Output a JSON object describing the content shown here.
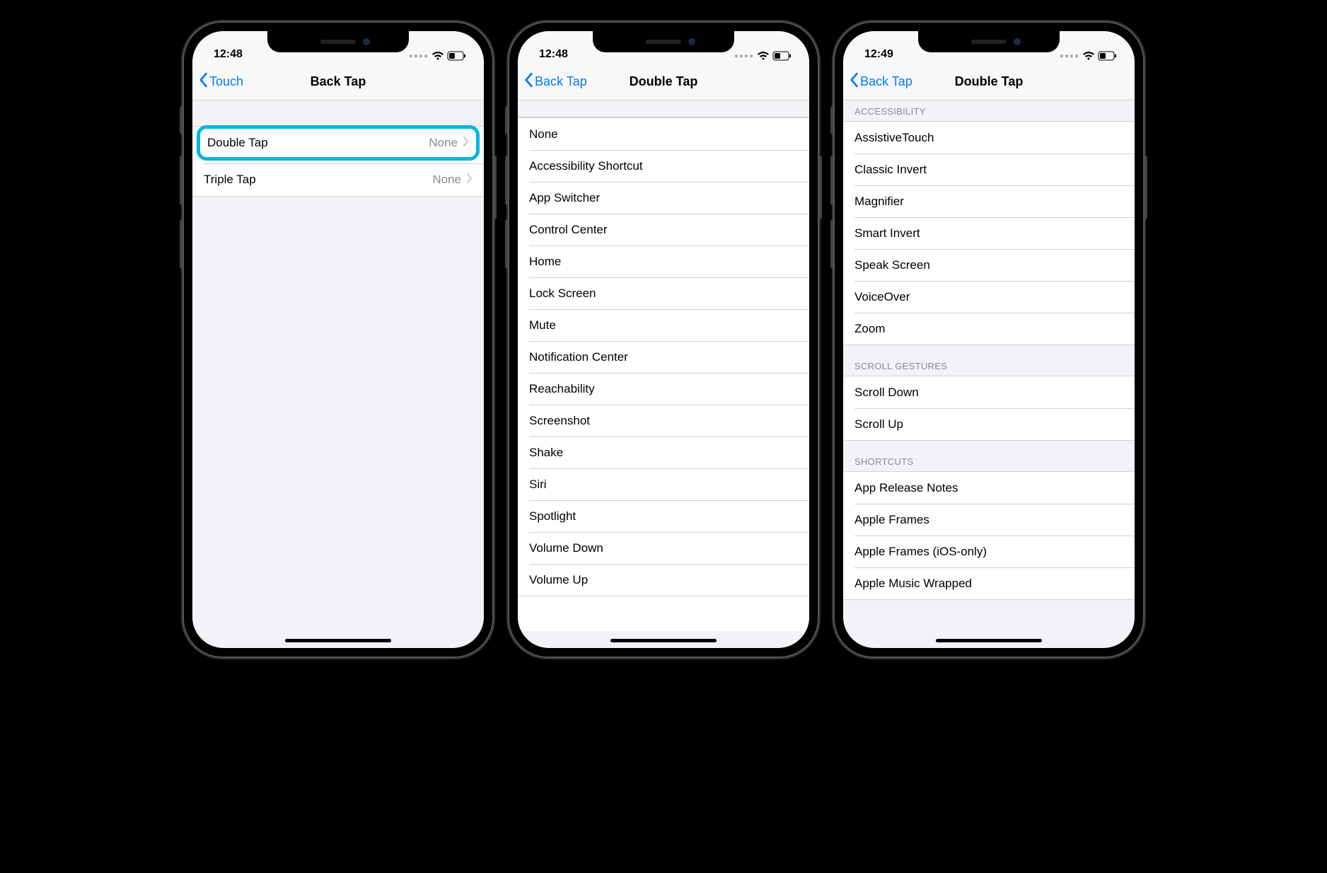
{
  "phones": [
    {
      "time": "12:48",
      "back_label": "Touch",
      "title": "Back Tap",
      "rows": [
        {
          "label": "Double Tap",
          "value": "None",
          "highlight": true
        },
        {
          "label": "Triple Tap",
          "value": "None",
          "highlight": false
        }
      ]
    },
    {
      "time": "12:48",
      "back_label": "Back Tap",
      "title": "Double Tap",
      "rows": [
        "None",
        "Accessibility Shortcut",
        "App Switcher",
        "Control Center",
        "Home",
        "Lock Screen",
        "Mute",
        "Notification Center",
        "Reachability",
        "Screenshot",
        "Shake",
        "Siri",
        "Spotlight",
        "Volume Down",
        "Volume Up"
      ]
    },
    {
      "time": "12:49",
      "back_label": "Back Tap",
      "title": "Double Tap",
      "sections": [
        {
          "header": "ACCESSIBILITY",
          "rows": [
            "AssistiveTouch",
            "Classic Invert",
            "Magnifier",
            "Smart Invert",
            "Speak Screen",
            "VoiceOver",
            "Zoom"
          ]
        },
        {
          "header": "SCROLL GESTURES",
          "rows": [
            "Scroll Down",
            "Scroll Up"
          ]
        },
        {
          "header": "SHORTCUTS",
          "rows": [
            "App Release Notes",
            "Apple Frames",
            "Apple Frames (iOS-only)",
            "Apple Music Wrapped"
          ]
        }
      ]
    }
  ]
}
